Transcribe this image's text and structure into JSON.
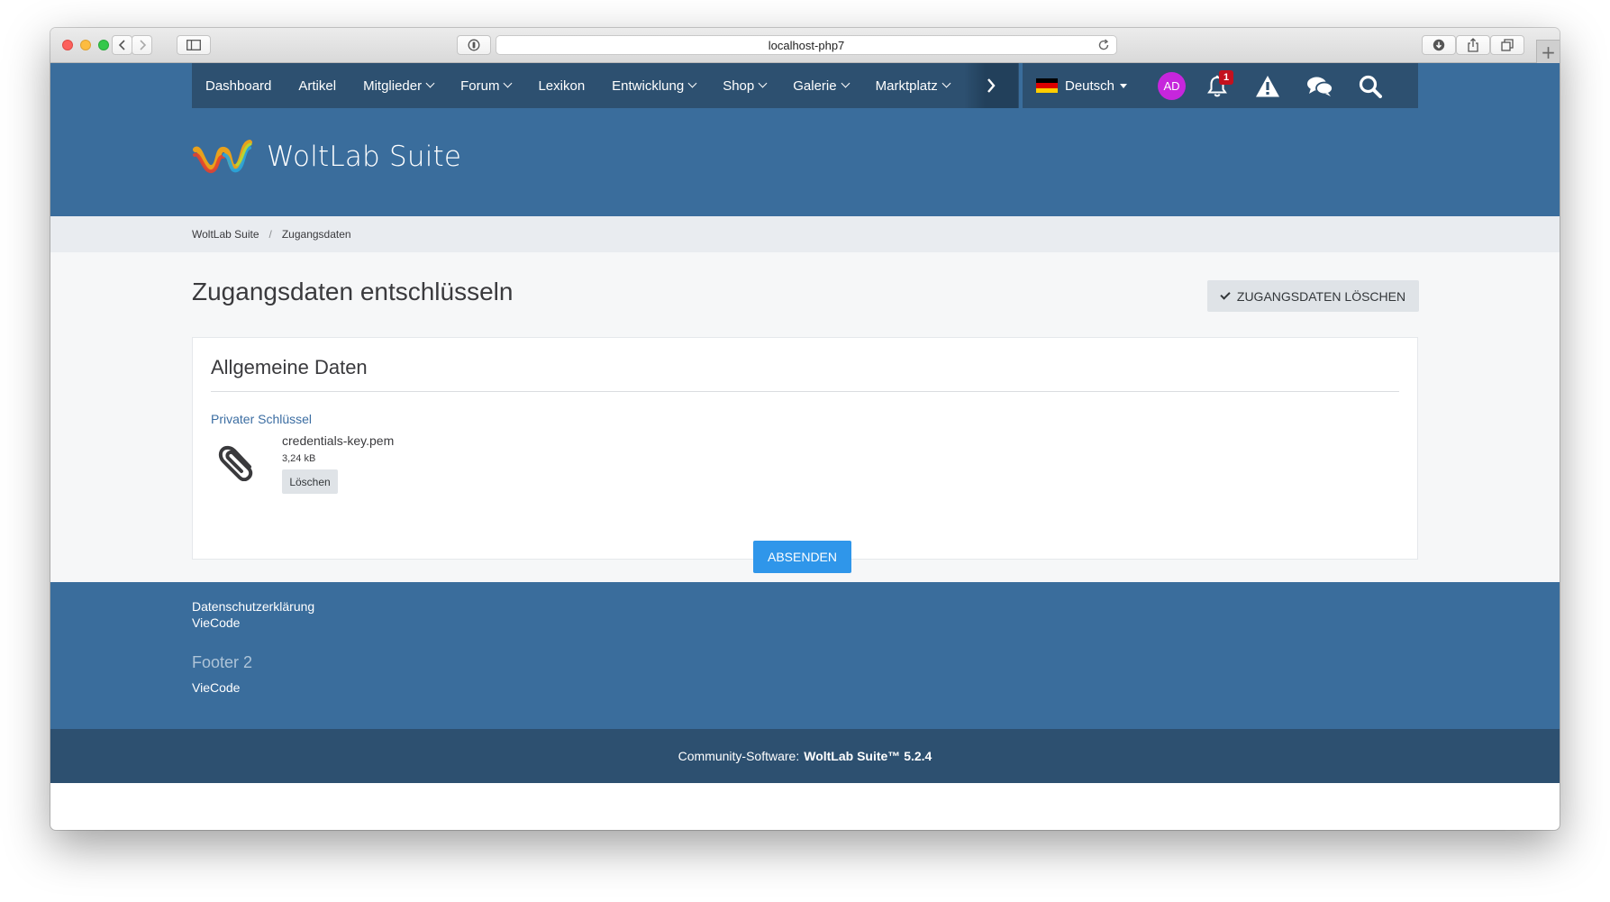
{
  "browser": {
    "url": "localhost-php7"
  },
  "nav": {
    "items": [
      {
        "label": "Dashboard",
        "dropdown": false
      },
      {
        "label": "Artikel",
        "dropdown": false
      },
      {
        "label": "Mitglieder",
        "dropdown": true
      },
      {
        "label": "Forum",
        "dropdown": true
      },
      {
        "label": "Lexikon",
        "dropdown": false
      },
      {
        "label": "Entwicklung",
        "dropdown": true
      },
      {
        "label": "Shop",
        "dropdown": true
      },
      {
        "label": "Galerie",
        "dropdown": true
      },
      {
        "label": "Marktplatz",
        "dropdown": true
      }
    ],
    "language": "Deutsch",
    "avatar_initials": "AD",
    "notification_count": "1",
    "icons": [
      "chevron-right-icon",
      "bell-icon",
      "warning-icon",
      "comments-icon",
      "search-icon"
    ]
  },
  "header": {
    "site_name": "WoltLab Suite"
  },
  "breadcrumb": {
    "items": [
      "WoltLab Suite",
      "Zugangsdaten"
    ],
    "separator": "/"
  },
  "main": {
    "title": "Zugangsdaten entschlüsseln",
    "delete_credentials_button": "ZUGANGSDATEN LÖSCHEN",
    "section_title": "Allgemeine Daten",
    "field_label": "Privater Schlüssel",
    "file": {
      "name": "credentials-key.pem",
      "size": "3,24 kB",
      "delete_label": "Löschen"
    },
    "submit_label": "ABSENDEN"
  },
  "footer": {
    "links_1": [
      "Datenschutzerklärung",
      "VieCode"
    ],
    "heading_2": "Footer 2",
    "links_2": [
      "VieCode"
    ],
    "copyright_prefix": "Community-Software:",
    "copyright_product": "WoltLab Suite™ 5.2.4"
  },
  "colors": {
    "brand_blue": "#3a6d9c",
    "nav_dark": "#2d5070",
    "submit_blue": "#2f96ea",
    "avatar": "#c626dc",
    "badge": "#c4111e"
  }
}
